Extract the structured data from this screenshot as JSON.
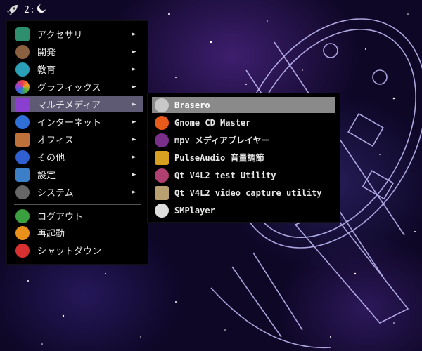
{
  "panel": {
    "workspace": "2:"
  },
  "main_menu": {
    "items": [
      {
        "label": "アクセサリ",
        "icon": "accessories-icon",
        "color": "#2e8f6e",
        "arrow": "►"
      },
      {
        "label": "開発",
        "icon": "development-icon",
        "color": "#8a6040",
        "arrow": "►"
      },
      {
        "label": "教育",
        "icon": "education-icon",
        "color": "#2a9fb8",
        "arrow": "►"
      },
      {
        "label": "グラフィックス",
        "icon": "graphics-icon",
        "color": "#d040a0",
        "arrow": "►"
      },
      {
        "label": "マルチメディア",
        "icon": "multimedia-icon",
        "color": "#8a3fd0",
        "arrow": "►"
      },
      {
        "label": "インターネット",
        "icon": "internet-icon",
        "color": "#2f6fd8",
        "arrow": "►"
      },
      {
        "label": "オフィス",
        "icon": "office-icon",
        "color": "#c0703a",
        "arrow": "►"
      },
      {
        "label": "その他",
        "icon": "other-icon",
        "color": "#2f5fd0",
        "arrow": "►"
      },
      {
        "label": "設定",
        "icon": "settings-icon",
        "color": "#3a7fc8",
        "arrow": "►"
      },
      {
        "label": "システム",
        "icon": "system-icon",
        "color": "#666666",
        "arrow": "►"
      }
    ],
    "session": [
      {
        "label": "ログアウト",
        "icon": "logout-icon",
        "color": "#3aa040"
      },
      {
        "label": "再起動",
        "icon": "reboot-icon",
        "color": "#e8901a"
      },
      {
        "label": "シャットダウン",
        "icon": "shutdown-icon",
        "color": "#d83030"
      }
    ]
  },
  "sub_menu": {
    "items": [
      {
        "label": "Brasero",
        "icon": "brasero-icon",
        "color": "#c8c8c8"
      },
      {
        "label": "Gnome CD Master",
        "icon": "gnome-cd-master-icon",
        "color": "#e85a1a"
      },
      {
        "label": "mpv メディアプレイヤー",
        "icon": "mpv-icon",
        "color": "#7a2f8a"
      },
      {
        "label": "PulseAudio 音量調節",
        "icon": "pulseaudio-icon",
        "color": "#d8a020"
      },
      {
        "label": "Qt V4L2 test Utility",
        "icon": "qt-v4l2-test-icon",
        "color": "#b04070"
      },
      {
        "label": "Qt V4L2 video capture utility",
        "icon": "qt-v4l2-capture-icon",
        "color": "#b8a070"
      },
      {
        "label": "SMPlayer",
        "icon": "smplayer-icon",
        "color": "#dddddd"
      }
    ]
  }
}
